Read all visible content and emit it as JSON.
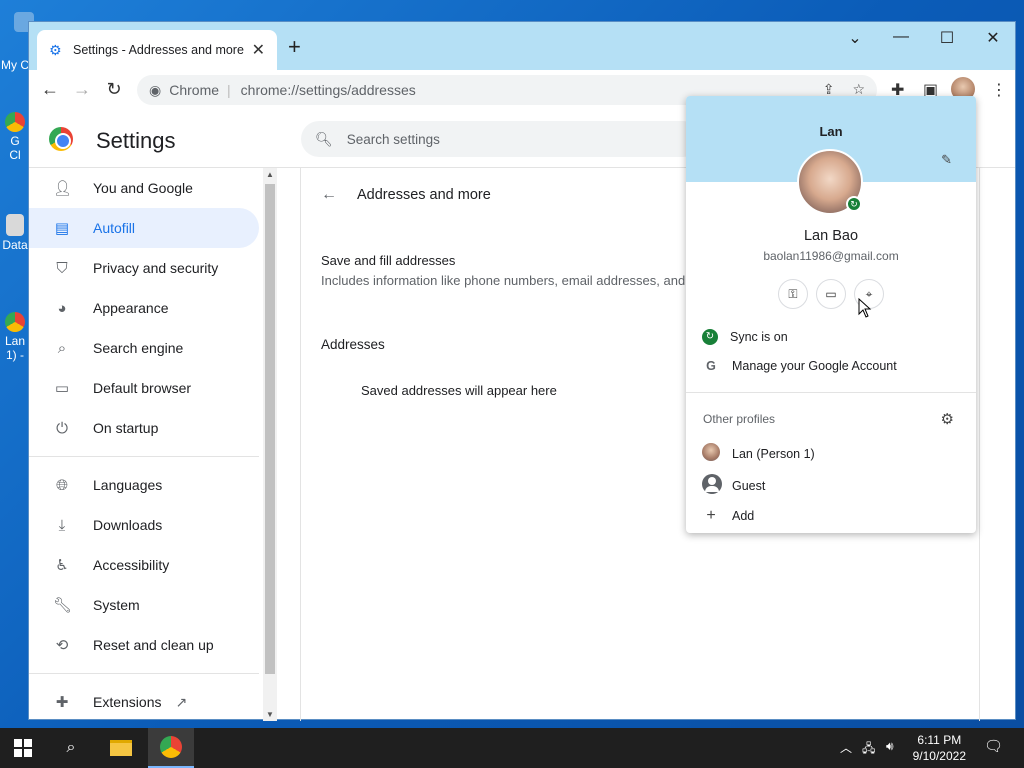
{
  "desktop": {
    "icons": [
      {
        "label": "My C"
      },
      {
        "label": "G"
      },
      {
        "label": "Cl"
      },
      {
        "label": "Data"
      },
      {
        "label": "Lan"
      },
      {
        "label": "1) -"
      }
    ]
  },
  "browser": {
    "tab_title": "Settings - Addresses and more",
    "new_tab": "+",
    "omnibox": {
      "site": "Chrome",
      "separator": "|",
      "url": "chrome://settings/addresses"
    }
  },
  "settings": {
    "title": "Settings",
    "search_placeholder": "Search settings",
    "nav": [
      {
        "label": "You and Google",
        "icon": "person-icon"
      },
      {
        "label": "Autofill",
        "icon": "clipboard-icon",
        "active": true
      },
      {
        "label": "Privacy and security",
        "icon": "shield-icon"
      },
      {
        "label": "Appearance",
        "icon": "palette-icon"
      },
      {
        "label": "Search engine",
        "icon": "search-icon"
      },
      {
        "label": "Default browser",
        "icon": "browser-icon"
      },
      {
        "label": "On startup",
        "icon": "power-icon"
      },
      {
        "label": "Languages",
        "icon": "globe-icon"
      },
      {
        "label": "Downloads",
        "icon": "download-icon"
      },
      {
        "label": "Accessibility",
        "icon": "accessibility-icon"
      },
      {
        "label": "System",
        "icon": "wrench-icon"
      },
      {
        "label": "Reset and clean up",
        "icon": "history-icon"
      },
      {
        "label": "Extensions",
        "icon": "puzzle-icon"
      }
    ],
    "page": {
      "heading": "Addresses and more",
      "save_title": "Save and fill addresses",
      "save_subtitle": "Includes information like phone numbers, email addresses, and",
      "addresses_heading": "Addresses",
      "empty_note": "Saved addresses will appear here"
    }
  },
  "profile_popup": {
    "name": "Lan",
    "full_name": "Lan Bao",
    "email": "baolan11986@gmail.com",
    "sync": "Sync is on",
    "manage": "Manage your Google Account",
    "other_profiles_label": "Other profiles",
    "profiles": [
      {
        "label": "Lan (Person 1)"
      },
      {
        "label": "Guest"
      },
      {
        "label": "Add"
      }
    ]
  },
  "taskbar": {
    "time": "6:11 PM",
    "date": "9/10/2022"
  },
  "colors": {
    "accent": "#1a73e8",
    "titlebar": "#b5e0f5",
    "active_nav_bg": "#e8f0fe",
    "sync_green": "#188038"
  }
}
